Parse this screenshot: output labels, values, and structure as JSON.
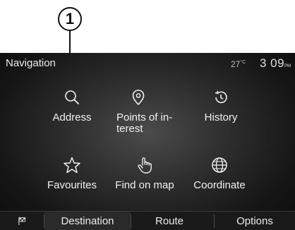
{
  "callout": {
    "number": "1"
  },
  "header": {
    "title": "Navigation",
    "temperature": "27",
    "temp_unit": "°C",
    "time": "3 09",
    "ampm": "PM"
  },
  "menu": [
    {
      "label": "Address",
      "icon": "search-icon"
    },
    {
      "label": "Points of in-\nterest",
      "icon": "location-pin-icon"
    },
    {
      "label": "History",
      "icon": "history-icon"
    },
    {
      "label": "Favourites",
      "icon": "star-icon"
    },
    {
      "label": "Find on map",
      "icon": "hand-pointer-icon"
    },
    {
      "label": "Coordinate",
      "icon": "globe-icon"
    }
  ],
  "tabs": {
    "flag_icon": "flag-icon",
    "destination": "Destination",
    "route": "Route",
    "options": "Options",
    "active": "Destination"
  }
}
